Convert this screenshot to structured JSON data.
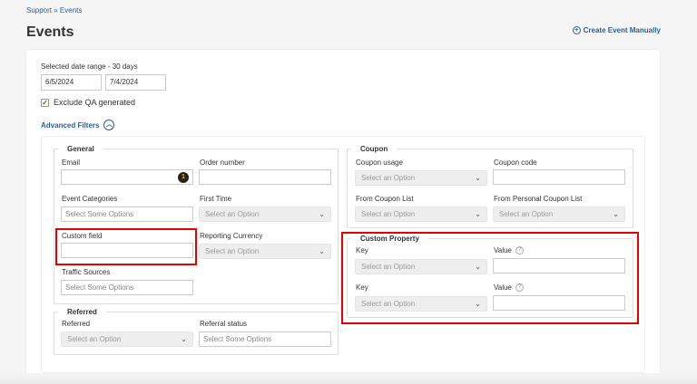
{
  "breadcrumb": "Support » Events",
  "title": "Events",
  "create_label": "Create Event Manually",
  "date": {
    "label": "Selected date range - 30 days",
    "start": "6/5/2024",
    "end": "7/4/2024"
  },
  "exclude_qa": {
    "label": "Exclude QA generated",
    "checked": true
  },
  "advanced_filters": "Advanced Filters",
  "general": {
    "legend": "General",
    "email": "Email",
    "order_number": "Order number",
    "event_categories": "Event Categories",
    "event_categories_placeholder": "Select Some Options",
    "first_time": "First Time",
    "first_time_placeholder": "Select an Option",
    "custom_field": "Custom field",
    "reporting_currency": "Reporting Currency",
    "reporting_currency_placeholder": "Select an Option",
    "traffic_sources": "Traffic Sources",
    "traffic_sources_placeholder": "Select Some Options"
  },
  "referred": {
    "legend": "Referred",
    "referred": "Referred",
    "referred_placeholder": "Select an Option",
    "referral_status": "Referral status",
    "referral_status_placeholder": "Select Some Options"
  },
  "coupon": {
    "legend": "Coupon",
    "coupon_usage": "Coupon usage",
    "coupon_usage_placeholder": "Select an Option",
    "coupon_code": "Coupon code",
    "from_coupon_list": "From Coupon List",
    "from_coupon_list_placeholder": "Select an Option",
    "from_personal_coupon_list": "From Personal Coupon List",
    "from_personal_coupon_list_placeholder": "Select an Option"
  },
  "custom_property": {
    "legend": "Custom Property",
    "rows": [
      {
        "key_label": "Key",
        "key_placeholder": "Select an Option",
        "value_label": "Value"
      },
      {
        "key_label": "Key",
        "key_placeholder": "Select an Option",
        "value_label": "Value"
      }
    ]
  },
  "colors": {
    "link": "#2d5f8f",
    "highlight": "#e60000"
  },
  "icons": {
    "create": "plus-circle-icon",
    "collapse": "chevron-up-icon",
    "caret": "chevron-down-icon",
    "help": "question-circle-icon",
    "email_badge": "password-manager-icon"
  }
}
